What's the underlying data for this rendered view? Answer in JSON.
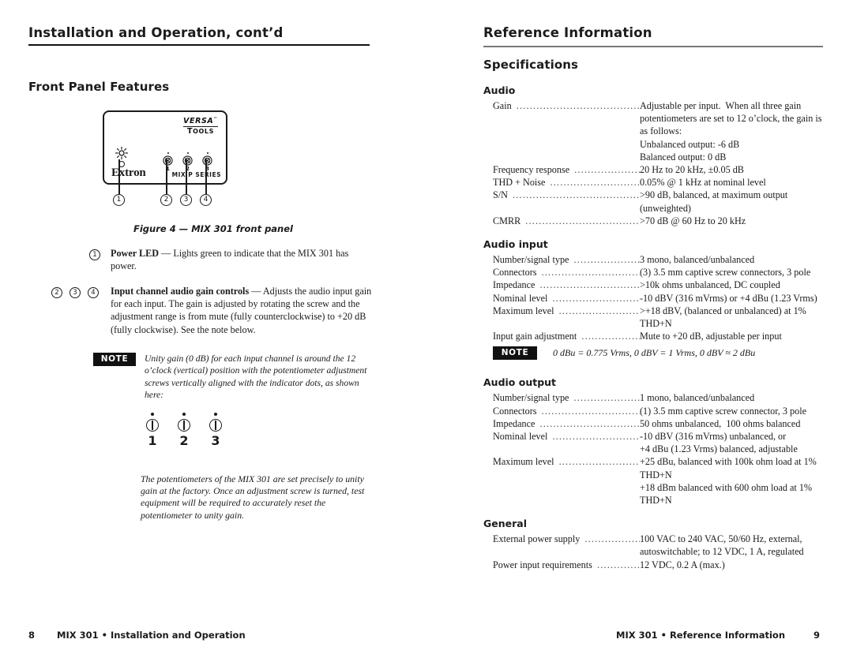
{
  "left_page": {
    "running_head": "Installation and Operation, cont’d",
    "section_heading": "Front Panel Features",
    "figure": {
      "caption": "Figure 4 — MIX 301 front panel",
      "brand_line1": "VERSA",
      "brand_tm": "™",
      "brand_line2_cap": "T",
      "brand_line2_rest": "OOLS",
      "logo": "Extron",
      "series_text": "MIX P SERIES",
      "pot_labels": [
        "1",
        "2",
        "3"
      ],
      "callouts": [
        "1",
        "2",
        "3",
        "4"
      ]
    },
    "items": [
      {
        "markers": [
          "1"
        ],
        "title": "Power LED",
        "dash": "—",
        "text": "Lights green to indicate that the MIX 301 has power."
      },
      {
        "markers": [
          "2",
          "3",
          "4"
        ],
        "title": "Input channel audio gain controls",
        "dash": "—",
        "text": "Adjusts the audio input gain for each input.  The gain is adjusted by rotating the screw and the adjustment range is from mute (fully counterclockwise) to +20 dB (fully clockwise).  See the note below."
      }
    ],
    "note": {
      "badge": "NOTE",
      "text": "Unity gain (0 dB) for each input channel is around the 12 o’clock (vertical) position with the potentiometer adjustment screws vertically aligned with the indicator dots, as shown here:"
    },
    "pot_demo_labels": [
      "1",
      "2",
      "3"
    ],
    "closing_para": "The potentiometers of the MIX 301 are set precisely to unity gain at the factory.  Once an adjustment screw is turned, test equipment will be required to accurately reset the potentiometer to unity gain.",
    "footer": {
      "page_number": "8",
      "text": "MIX 301 • Installation and Operation"
    }
  },
  "right_page": {
    "running_head": "Reference Information",
    "section_heading": "Specifications",
    "groups": [
      {
        "title": "Audio",
        "rows": [
          {
            "label": "Gain",
            "value": "Adjustable per input.  When all three gain potentiometers are set to 12 o’clock, the gain is as follows:\nUnbalanced output: -6 dB\nBalanced output: 0 dB"
          },
          {
            "label": "Frequency  response",
            "value": "20 Hz to 20 kHz, ±0.05 dB"
          },
          {
            "label": "THD + Noise",
            "value": "0.05% @ 1 kHz at nominal level"
          },
          {
            "label": "S/N",
            "value": ">90 dB, balanced, at maximum output (unweighted)"
          },
          {
            "label": "CMRR",
            "value": ">70 dB @ 60 Hz to 20 kHz"
          }
        ]
      },
      {
        "title": "Audio input",
        "rows": [
          {
            "label": "Number/signal type",
            "value": "3 mono, balanced/unbalanced"
          },
          {
            "label": "Connectors",
            "value": "(3) 3.5 mm captive screw connectors, 3 pole"
          },
          {
            "label": "Impedance",
            "value": ">10k ohms unbalanced, DC coupled"
          },
          {
            "label": "Nominal level",
            "value": "-10 dBV (316 mVrms) or +4 dBu (1.23 Vrms)"
          },
          {
            "label": "Maximum level",
            "value": ">+18 dBV, (balanced or unbalanced) at 1% THD+N"
          },
          {
            "label": "Input gain adjustment",
            "value": "Mute to +20 dB, adjustable per input"
          }
        ],
        "note": {
          "badge": "NOTE",
          "text": "0 dBu = 0.775 Vrms,  0 dBV = 1 Vrms,  0 dBV ≈ 2 dBu"
        }
      },
      {
        "title": "Audio output",
        "rows": [
          {
            "label": "Number/signal type",
            "value": "1 mono, balanced/unbalanced"
          },
          {
            "label": "Connectors",
            "value": "(1) 3.5 mm captive screw connector, 3 pole"
          },
          {
            "label": "Impedance",
            "value": "50 ohms unbalanced,  100 ohms balanced"
          },
          {
            "label": "Nominal level",
            "value": "-10 dBV (316 mVrms) unbalanced, or\n+4 dBu (1.23 Vrms) balanced, adjustable"
          },
          {
            "label": "Maximum level",
            "value": "+25 dBu, balanced with 100k ohm load at 1% THD+N\n+18 dBm balanced with 600 ohm load at 1% THD+N"
          }
        ]
      },
      {
        "title": "General",
        "rows": [
          {
            "label": "External power supply",
            "value": "100 VAC to 240 VAC, 50/60 Hz, external, autoswitchable; to 12 VDC, 1 A, regulated"
          },
          {
            "label": "Power input requirements",
            "value": "12 VDC, 0.2 A (max.)"
          }
        ]
      }
    ],
    "footer": {
      "page_number": "9",
      "text": "MIX 301 • Reference Information"
    }
  },
  "colors": {
    "ink": "#1b1b1b",
    "rule_black": "#111111",
    "rule_gray": "#777777"
  }
}
